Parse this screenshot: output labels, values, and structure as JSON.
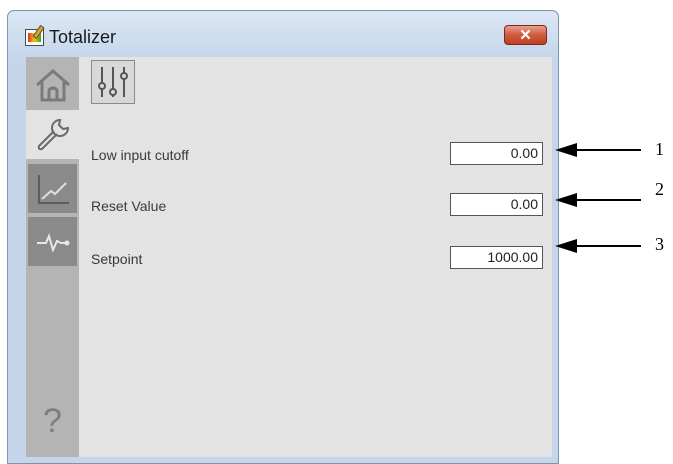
{
  "window": {
    "title": "Totalizer",
    "close_label": "✕"
  },
  "sidebar": {
    "items": [
      {
        "icon": "home-icon"
      },
      {
        "icon": "wrench-icon"
      },
      {
        "icon": "trend-icon"
      },
      {
        "icon": "alarm-pulse-icon"
      }
    ],
    "help_label": "?"
  },
  "main": {
    "tab_icon": "sliders-icon",
    "rows": [
      {
        "label": "Low input cutoff",
        "value": "0.00"
      },
      {
        "label": "Reset Value",
        "value": "0.00"
      },
      {
        "label": "Setpoint",
        "value": "1000.00"
      }
    ]
  },
  "callouts": [
    "1",
    "2",
    "3"
  ],
  "colors": {
    "title_bar": "#c6d7eb",
    "close_button": "#cf5a3e",
    "content_bg": "#e3e3e3",
    "sidebar_bg": "#b4b4b4"
  }
}
